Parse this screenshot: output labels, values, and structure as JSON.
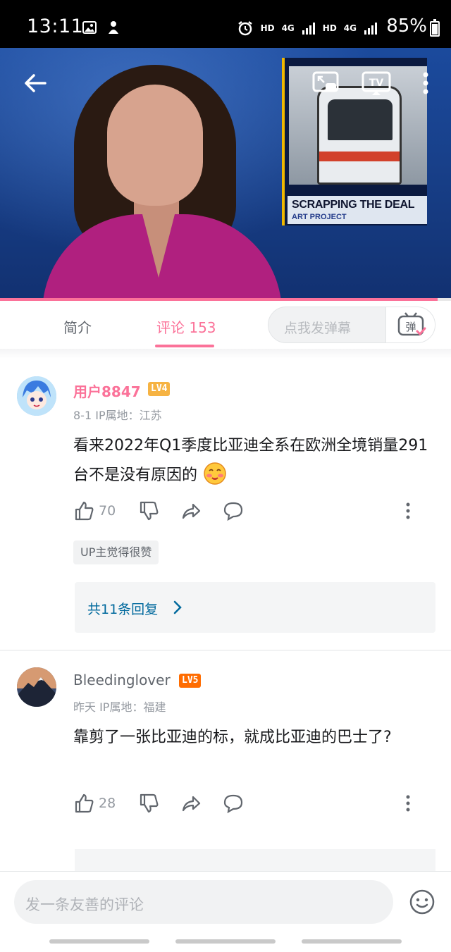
{
  "status_bar": {
    "time": "13:11",
    "net_labels": [
      "HD",
      "4G",
      "HD",
      "4G"
    ],
    "battery": "85%"
  },
  "video": {
    "inset_title": "SCRAPPING THE DEAL",
    "inset_subtitle": "ART PROJECT",
    "progress_fraction": 0.97
  },
  "tabs": {
    "intro": "简介",
    "comments": "评论",
    "comment_count": "153",
    "danmaku_placeholder": "点我发弹幕",
    "danmaku_icon_text": "弹"
  },
  "comments": [
    {
      "username": "用户8847",
      "level": "LV4",
      "username_color": "#fb7299",
      "level_color": "#f6b343",
      "meta": "8-1  IP属地：江苏",
      "body": "看来2022年Q1季度比亚迪全系在欧洲全境销量291台不是没有原因的",
      "likes": "70",
      "tag": "UP主觉得很赞",
      "replies": "共11条回复"
    },
    {
      "username": "Bleedinglover",
      "level": "LV5",
      "username_color": "#61666d",
      "level_color": "#ff6c00",
      "meta": "昨天  IP属地：福建",
      "body": "靠剪了一张比亚迪的标，就成比亚迪的巴士了?",
      "likes": "28"
    }
  ],
  "bottom": {
    "placeholder": "发一条友善的评论"
  },
  "colors": {
    "accent": "#fb7299",
    "reply_link": "#00699d"
  }
}
